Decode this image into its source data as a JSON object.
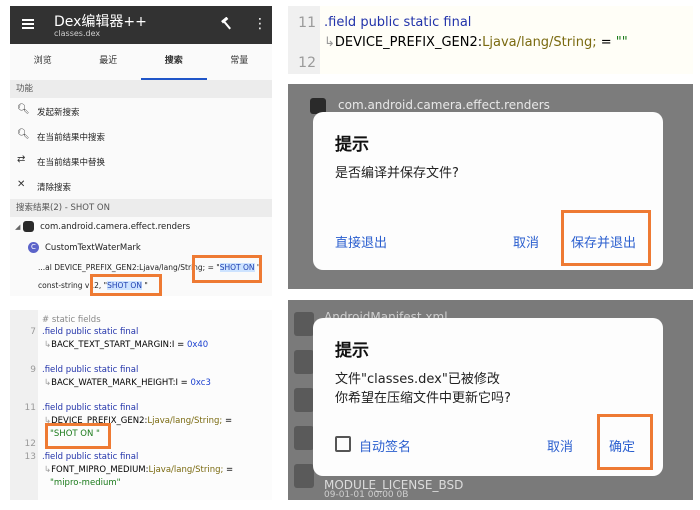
{
  "app": {
    "title": "Dex编辑器++",
    "subtitle": "classes.dex",
    "hammer_icon": "hammer-icon",
    "more_icon": "more-vert-icon"
  },
  "tabs": [
    {
      "label": "浏览"
    },
    {
      "label": "最近"
    },
    {
      "label": "搜索",
      "active": true
    },
    {
      "label": "常量"
    }
  ],
  "functions": {
    "header": "功能",
    "items": [
      {
        "icon": "search-icon",
        "label": "发起新搜索"
      },
      {
        "icon": "search-icon",
        "label": "在当前结果中搜索"
      },
      {
        "icon": "replace-icon",
        "label": "在当前结果中替换"
      },
      {
        "icon": "close-icon",
        "label": "清除搜索"
      }
    ]
  },
  "results": {
    "header": "搜索结果(2) - SHOT ON",
    "package": "com.android.camera.effect.renders",
    "class_badge": "C",
    "class_name": "CustomTextWaterMark",
    "match1_prefix": "...al DEVICE_PREFIX_GEN2:Ljava/lang/String; = \"",
    "match1_hl": "SHOT ON",
    "match1_suffix": " \"",
    "match2_prefix": "const-string v12, \"",
    "match2_hl": "SHOT ON",
    "match2_suffix": " \""
  },
  "code_left": {
    "comment": "# static fields",
    "lines": [
      {
        "num": "7",
        "kw": ".field public static final",
        "name": "BACK_TEXT_START_MARGIN:I = ",
        "value": "0x40"
      },
      {
        "num": "9",
        "kw": ".field public static final",
        "name": "BACK_WATER_MARK_HEIGHT:I = ",
        "value": "0xc3"
      },
      {
        "num": "11",
        "kw": ".field public static final",
        "name": "DEVICE_PREFIX_GEN2:",
        "type": "Ljava/lang/String;",
        "eq": " = ",
        "value": "\"SHOT ON \""
      },
      {
        "num": "13",
        "kw": ".field public static final",
        "name": "FONT_MIPRO_MEDIUM:",
        "type": "Ljava/lang/String;",
        "eq": " = ",
        "value": "\"mipro-medium\""
      }
    ],
    "extra_num": "12"
  },
  "code_right": {
    "line1_num": "11",
    "line1": ".field public static final",
    "line2_name": "DEVICE_PREFIX_GEN2:",
    "line2_type": "Ljava/lang/String;",
    "line2_eq": " = ",
    "line2_value": "\"\"",
    "line3_num": "12"
  },
  "dialog1": {
    "bg_row": "com.android.camera.effect.renders",
    "title": "提示",
    "message": "是否编译并保存文件?",
    "btn_exit": "直接退出",
    "btn_cancel": "取消",
    "btn_save": "保存并退出"
  },
  "dialog2": {
    "bg_row_top": "AndroidManifest.xml",
    "bg_row_bottom": "MODULE_LICENSE_BSD",
    "bg_row_bottom_meta": "09-01-01 00:00  0B",
    "title": "提示",
    "message_line1": "文件\"classes.dex\"已被修改",
    "message_line2": "你希望在压缩文件中更新它吗?",
    "checkbox_label": "自动签名",
    "btn_cancel": "取消",
    "btn_ok": "确定"
  },
  "colors": {
    "accent": "#2b5fcf",
    "highlight_box": "#ee7a33",
    "appbar": "#323232"
  }
}
